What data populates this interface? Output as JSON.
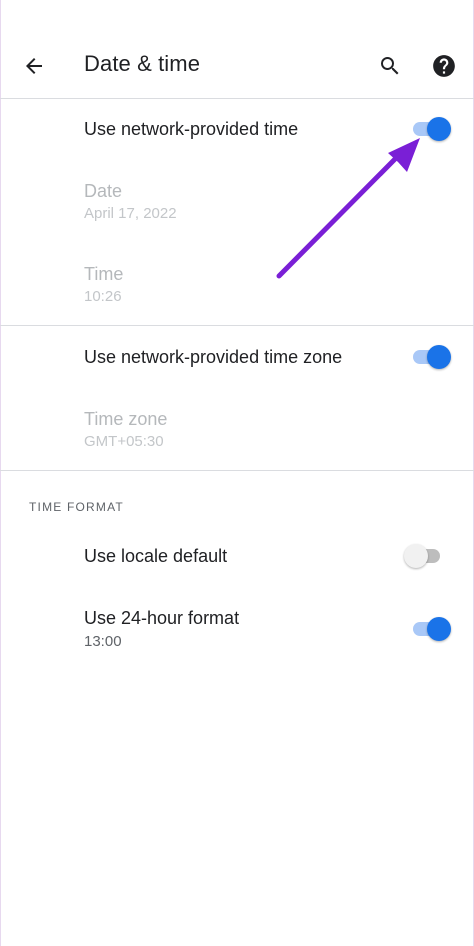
{
  "appbar": {
    "title": "Date & time",
    "back_icon": "arrow-back-icon",
    "search_icon": "search-icon",
    "help_icon": "help-icon"
  },
  "settings": {
    "network_time": {
      "label": "Use network-provided time",
      "enabled": true
    },
    "date": {
      "label": "Date",
      "value": "April 17, 2022"
    },
    "time": {
      "label": "Time",
      "value": "10:26"
    },
    "network_time_zone": {
      "label": "Use network-provided time zone",
      "enabled": true
    },
    "time_zone": {
      "label": "Time zone",
      "value": "GMT+05:30"
    }
  },
  "time_format": {
    "header": "TIME FORMAT",
    "locale_default": {
      "label": "Use locale default",
      "enabled": false
    },
    "hour24": {
      "label": "Use 24-hour format",
      "value": "13:00",
      "enabled": true
    }
  },
  "colors": {
    "accent": "#1a73e8",
    "annotation_arrow": "#7a1fd6"
  }
}
